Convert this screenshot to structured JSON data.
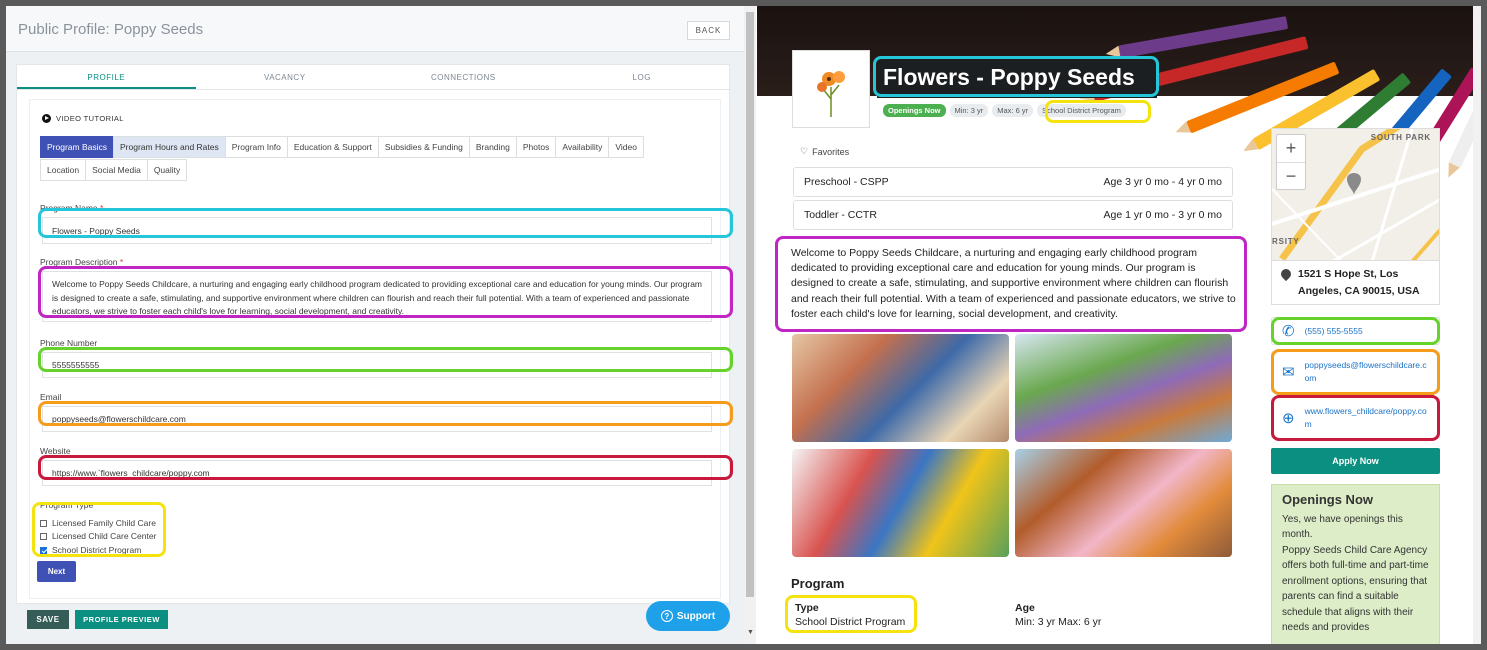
{
  "editor": {
    "title": "Public Profile: Poppy Seeds",
    "back_label": "BACK",
    "tabs": [
      "PROFILE",
      "VACANCY",
      "CONNECTIONS",
      "LOG"
    ],
    "video_tutorial": "VIDEO TUTORIAL",
    "subtabs_row1": [
      "Program Basics",
      "Program Hours and Rates",
      "Program Info",
      "Education & Support",
      "Subsidies & Funding",
      "Branding",
      "Photos",
      "Availability",
      "Video"
    ],
    "subtabs_row2": [
      "Location",
      "Social Media",
      "Quality"
    ],
    "program_name_label": "Program Name",
    "program_name_value": "Flowers - Poppy Seeds",
    "program_desc_label": "Program Description",
    "program_desc_value": "Welcome to Poppy Seeds Childcare, a nurturing and engaging early childhood program dedicated to providing exceptional care and education for young minds. Our program is designed to create a safe, stimulating, and supportive environment where children can flourish and reach their full potential. With a team of experienced and passionate educators, we strive to foster each child's love for learning, social development, and creativity.",
    "phone_label": "Phone Number",
    "phone_value": "5555555555",
    "email_label": "Email",
    "email_value": "poppyseeds@flowerschildcare.com",
    "website_label": "Website",
    "website_value": "https://www.`flowers_childcare/poppy.com",
    "program_type_label": "Program Type",
    "required_mark": "*",
    "program_types": [
      {
        "label": "Licensed Family Child Care",
        "checked": false
      },
      {
        "label": "Licensed Child Care Center",
        "checked": false
      },
      {
        "label": "School District Program",
        "checked": true
      }
    ],
    "next_label": "Next",
    "save_label": "SAVE",
    "preview_label": "PROFILE PREVIEW",
    "support_label": "Support"
  },
  "preview": {
    "title": "Flowers - Poppy Seeds",
    "chips": [
      "Openings Now",
      "Min: 3 yr",
      "Max: 6 yr",
      "School District Program"
    ],
    "favorites": "Favorites",
    "age_groups": [
      {
        "name": "Preschool - CSPP",
        "age": "Age 3 yr 0 mo - 4 yr 0 mo"
      },
      {
        "name": "Toddler - CCTR",
        "age": "Age 1 yr 0 mo - 3 yr 0 mo"
      }
    ],
    "description": "Welcome to Poppy Seeds Childcare, a nurturing and engaging early childhood program dedicated to providing exceptional care and education for young minds. Our program is designed to create a safe, stimulating, and supportive environment where children can flourish and reach their full potential. With a team of experienced and passionate educators, we strive to foster each child's love for learning, social development, and creativity.",
    "program_heading": "Program",
    "type_label": "Type",
    "type_value": "School District Program",
    "age_label": "Age",
    "age_value": "Min: 3 yr Max: 6 yr",
    "map_label": "SOUTH PARK",
    "map_label2": "RSITY",
    "address": "1521 S Hope St, Los Angeles, CA 90015, USA",
    "phone": "(555) 555-5555",
    "email": "poppyseeds@flowerschildcare.com",
    "website": "www.flowers_childcare/poppy.com",
    "apply_label": "Apply Now",
    "openings_title": "Openings Now",
    "openings_text": "Yes, we have openings this month.",
    "openings_text2": "Poppy Seeds Child Care Agency offers both full-time and part-time enrollment options, ensuring that parents can find a suitable schedule that aligns with their needs and provides"
  },
  "colors": {
    "teal": "#0a8f80",
    "indigo": "#3f51b5",
    "ring_cyan": "#26c6da",
    "ring_magenta": "#c026c4",
    "ring_green": "#66d22c",
    "ring_orange": "#f59c1a",
    "ring_red": "#c8183c",
    "ring_yellow": "#f5e30f"
  }
}
